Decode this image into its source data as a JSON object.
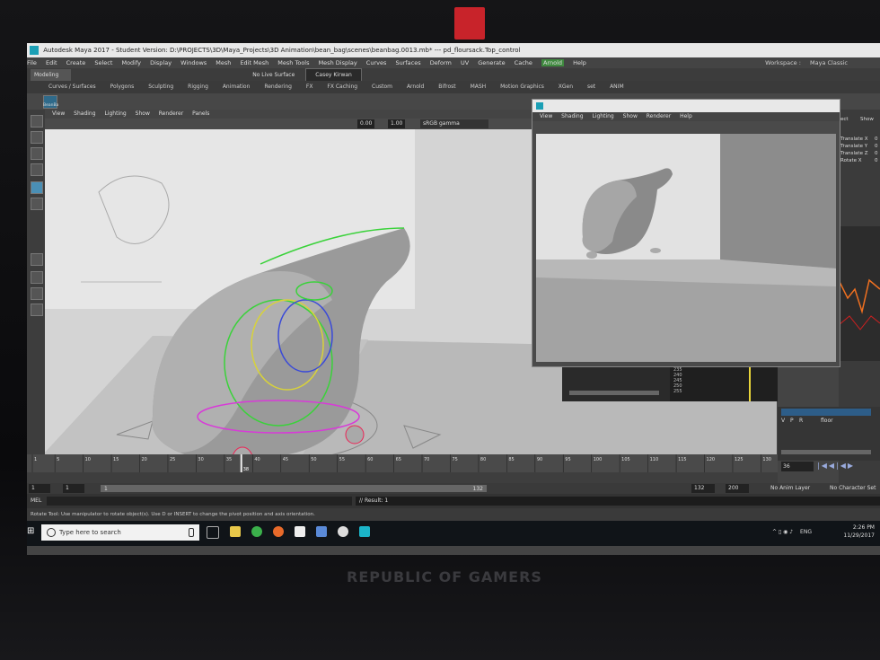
{
  "window": {
    "title": "Autodesk Maya 2017 - Student Version: D:\\PROJECTS\\3D\\Maya_Projects\\3D Animation\\bean_bag\\scenes\\beanbag.0013.mb* --- pd_floursack.Top_control"
  },
  "menu": [
    "File",
    "Edit",
    "Create",
    "Select",
    "Modify",
    "Display",
    "Windows",
    "Mesh",
    "Edit Mesh",
    "Mesh Tools",
    "Mesh Display",
    "Curves",
    "Surfaces",
    "Deform",
    "UV",
    "Generate",
    "Cache",
    "Arnold",
    "Help"
  ],
  "workspace": {
    "label": "Workspace :",
    "value": "Maya Classic"
  },
  "status_line": {
    "mode": "Modeling",
    "live_surface": "No Live Surface",
    "user": "Casey Kirwan"
  },
  "shelf_tabs": [
    "Curves / Surfaces",
    "Polygons",
    "Sculpting",
    "Rigging",
    "Animation",
    "Rendering",
    "FX",
    "FX Caching",
    "Custom",
    "Arnold",
    "Bifrost",
    "MASH",
    "Motion Graphics",
    "XGen",
    "set",
    "ANIM"
  ],
  "shelf_tool_label": "BeanBa",
  "viewport1": {
    "menu": [
      "View",
      "Shading",
      "Lighting",
      "Show",
      "Renderer",
      "Panels"
    ],
    "near": "0.00",
    "far": "1.00",
    "color_space": "sRGB gamma"
  },
  "viewport2": {
    "menu": [
      "View",
      "Shading",
      "Lighting",
      "Show",
      "Renderer",
      "Help"
    ]
  },
  "channel_box": {
    "tabs": [
      "ect",
      "Show"
    ],
    "attributes": [
      "Translate X",
      "Translate Y",
      "Translate Z",
      "Rotate X"
    ],
    "values": [
      "0",
      "0",
      "0",
      "0"
    ]
  },
  "graph_frames": [
    "235",
    "240",
    "245",
    "250",
    "255"
  ],
  "outliner": {
    "item": "floor",
    "flags": [
      "V",
      "P",
      "R"
    ]
  },
  "timeline": {
    "ticks": [
      "1",
      "5",
      "10",
      "15",
      "20",
      "25",
      "30",
      "35",
      "40",
      "45",
      "50",
      "55",
      "60",
      "65",
      "70",
      "75",
      "80",
      "85",
      "90",
      "95",
      "100",
      "105",
      "110",
      "115",
      "120",
      "125",
      "130"
    ],
    "current_frame": "36",
    "cursor_frame": "38"
  },
  "range": {
    "start": "1",
    "anim_start": "1",
    "range_start": "1",
    "range_end": "132",
    "anim_end": "132",
    "max_end": "200",
    "anim_layer": "No Anim Layer",
    "character_set": "No Character Set"
  },
  "command_line": {
    "lang": "MEL",
    "result": "// Result: 1"
  },
  "help_line": "Rotate Tool: Use manipulator to rotate object(s). Use D or INSERT to change the pivot position and axis orientation.",
  "taskbar": {
    "search_placeholder": "Type here to search",
    "time": "2:26 PM",
    "date": "11/29/2017",
    "lang": "ENG"
  },
  "bezel_brand": "REPUBLIC OF GAMERS",
  "colors": {
    "maya_blue": "#1bb4c8",
    "key_red": "#d02020",
    "camera_red": "#c8232a"
  }
}
